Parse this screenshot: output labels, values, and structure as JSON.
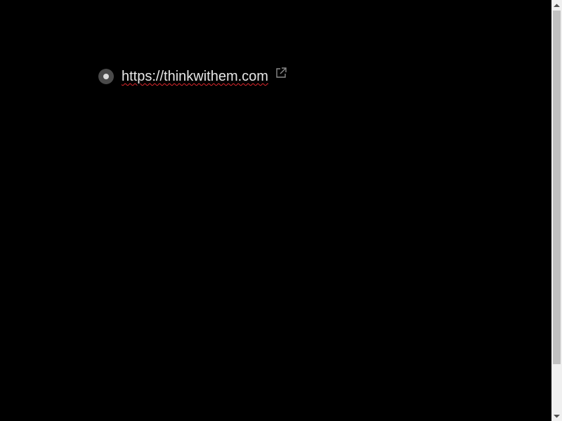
{
  "outline": {
    "items": [
      {
        "text": "https://thinkwithem.com",
        "bullet_icon": "bullet-dot-icon",
        "link_icon": "external-link-icon"
      }
    ]
  },
  "colors": {
    "background": "#000000",
    "text": "#e8e8e8",
    "spellcheck_underline": "#e0282d",
    "bullet": "#4a4a4a",
    "scrollbar_track": "#f0f0f0",
    "scrollbar_thumb": "#c1c1c1"
  },
  "scrollbar": {
    "up_icon": "scroll-up-arrow-icon",
    "down_icon": "scroll-down-arrow-icon"
  }
}
